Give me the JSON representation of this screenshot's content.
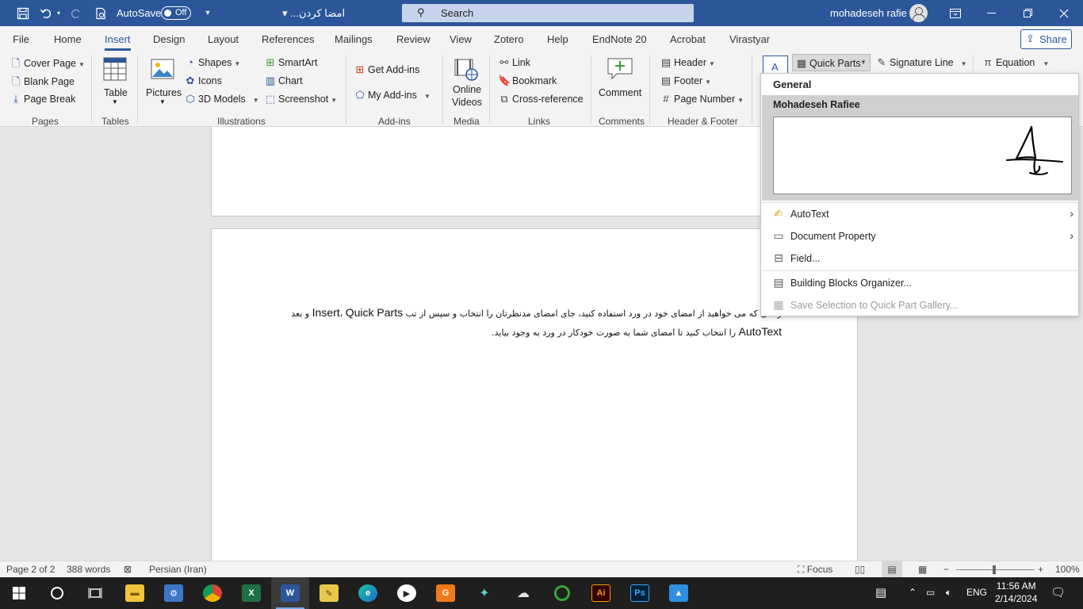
{
  "titlebar": {
    "autosave_label": "AutoSave",
    "autosave_state": "Off",
    "document_title": "امضا کردن...",
    "search_placeholder": "Search",
    "username": "mohadeseh rafie",
    "icons": [
      "save-icon",
      "undo-icon",
      "redo-icon",
      "print-preview-icon",
      "customize-icon",
      "ribbon-display-icon",
      "minimize-icon",
      "restore-icon",
      "close-icon"
    ]
  },
  "menu": {
    "tabs": [
      "File",
      "Home",
      "Insert",
      "Design",
      "Layout",
      "References",
      "Mailings",
      "Review",
      "View",
      "Zotero",
      "Help",
      "EndNote 20",
      "Acrobat",
      "Virastyar"
    ],
    "active_tab": "Insert",
    "share_label": "Share"
  },
  "ribbon": {
    "pages": {
      "cover_page": "Cover Page",
      "blank_page": "Blank Page",
      "page_break": "Page Break",
      "group": "Pages"
    },
    "tables": {
      "table": "Table",
      "group": "Tables"
    },
    "illustrations": {
      "pictures": "Pictures",
      "shapes": "Shapes",
      "icons": "Icons",
      "models_3d": "3D Models",
      "smartart": "SmartArt",
      "chart": "Chart",
      "screenshot": "Screenshot",
      "group": "Illustrations"
    },
    "addins": {
      "get_addins": "Get Add-ins",
      "my_addins": "My Add-ins",
      "group": "Add-ins"
    },
    "media": {
      "online_videos_1": "Online",
      "online_videos_2": "Videos",
      "group": "Media"
    },
    "links": {
      "link": "Link",
      "bookmark": "Bookmark",
      "cross_reference": "Cross-reference",
      "group": "Links"
    },
    "comments": {
      "comment": "Comment",
      "group": "Comments"
    },
    "header_footer": {
      "header": "Header",
      "footer": "Footer",
      "page_number": "Page Number",
      "group": "Header & Footer"
    },
    "text": {
      "quick_parts": "Quick Parts",
      "signature_line": "Signature Line",
      "equation": "Equation"
    }
  },
  "document": {
    "line1_fa_a": "و بعد",
    "line1_lat_a": "Quick Parts",
    "line1_fa_b": "،",
    "line1_lat_b": "Insert",
    "line1_fa_c": "زمانی که می خواهید از امضای خود در ورد استفاده کنید، جای امضای مدنظرتان را انتخاب و سپس از تب",
    "line2_lat": "AutoText",
    "line2_fa": "را انتخاب کنید تا امضای شما به صورت خودکار در ورد به وجود بیاید."
  },
  "quick_parts_menu": {
    "category": "General",
    "entry_name": "Mohadeseh Rafiee",
    "items": [
      {
        "label": "AutoText",
        "icon": "autotext-icon",
        "submenu": true,
        "enabled": true
      },
      {
        "label": "Document Property",
        "icon": "document-property-icon",
        "submenu": true,
        "enabled": true
      },
      {
        "label": "Field...",
        "icon": "field-icon",
        "submenu": false,
        "enabled": true
      },
      {
        "label": "Building Blocks Organizer...",
        "icon": "building-blocks-icon",
        "submenu": false,
        "enabled": true
      },
      {
        "label": "Save Selection to Quick Part Gallery...",
        "icon": "save-selection-icon",
        "submenu": false,
        "enabled": false
      }
    ]
  },
  "statusbar": {
    "page": "Page 2 of 2",
    "words": "388 words",
    "language": "Persian (Iran)",
    "focus": "Focus",
    "zoom": "100%"
  },
  "taskbar": {
    "apps": [
      "file-explorer",
      "control-panel",
      "chrome",
      "excel",
      "word",
      "sticky-app",
      "edge",
      "media-player",
      "pdf-app",
      "app-green",
      "app-bird",
      "app-circle",
      "illustrator",
      "photoshop",
      "photos"
    ],
    "language": "ENG",
    "time": "11:56 AM",
    "date": "2/14/2024"
  },
  "colors": {
    "brand": "#2b579a",
    "ribbon_bg": "#f3f3f3",
    "taskbar_bg": "#1f1f1f"
  }
}
